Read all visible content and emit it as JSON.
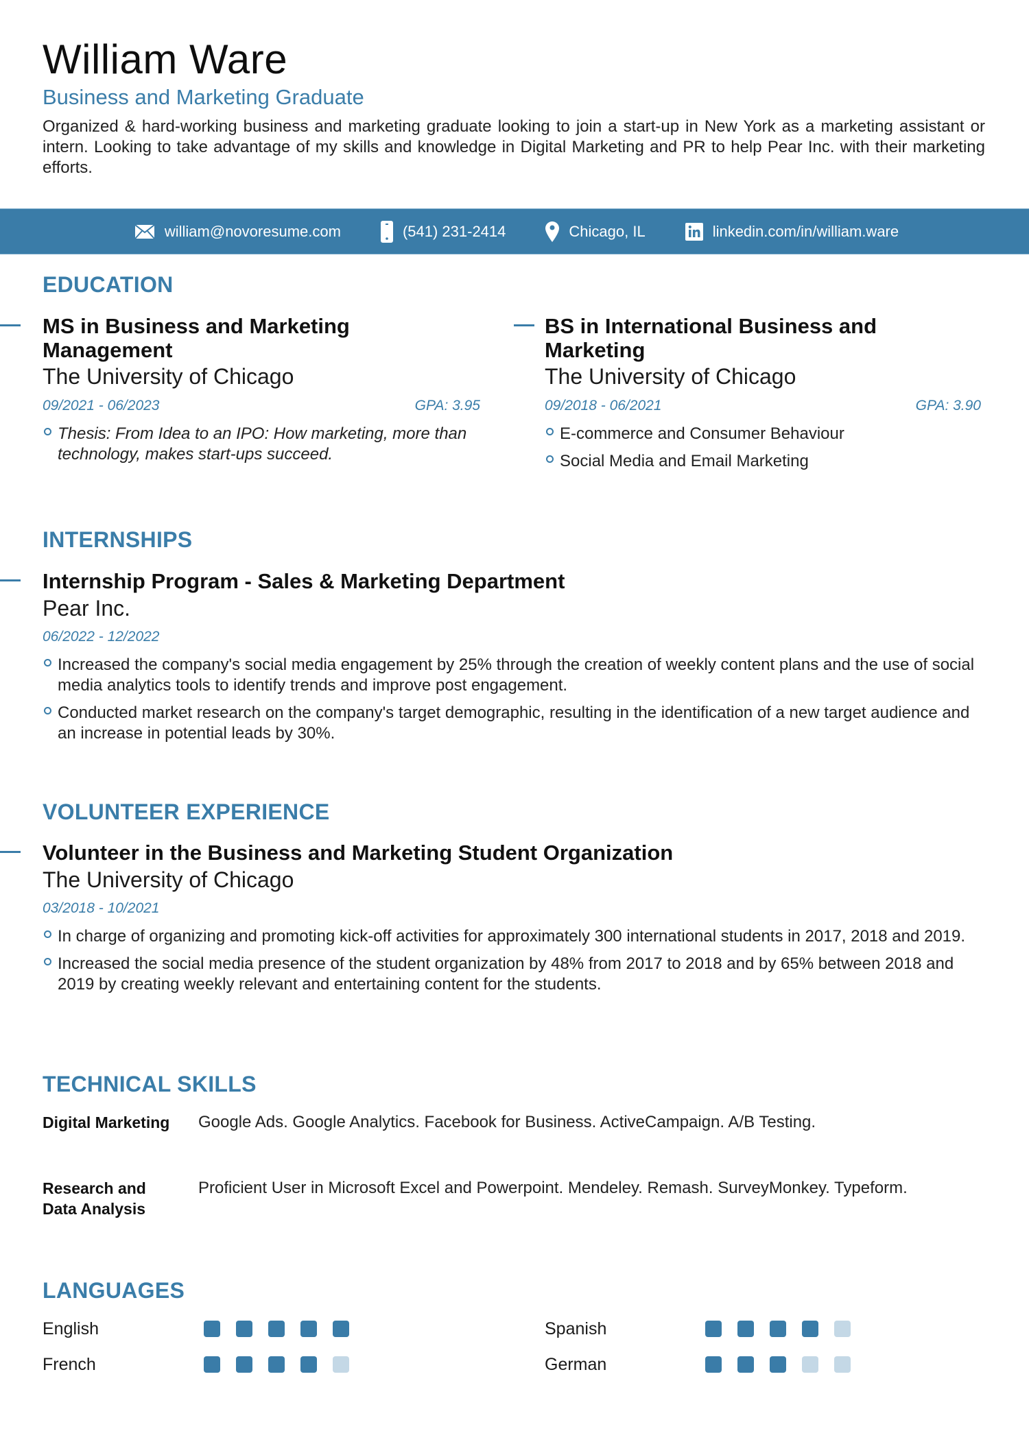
{
  "header": {
    "name": "William Ware",
    "headline": "Business and Marketing Graduate",
    "summary": "Organized & hard-working business and marketing graduate looking to join a start-up in New York as a marketing assistant or intern. Looking to take advantage of my skills and knowledge in Digital Marketing and PR to help Pear Inc. with their marketing efforts."
  },
  "contact": {
    "email": {
      "icon": "envelope-icon",
      "text": "william@novoresume.com"
    },
    "phone": {
      "icon": "phone-icon",
      "text": "(541) 231-2414"
    },
    "location": {
      "icon": "map-pin-icon",
      "text": "Chicago, IL"
    },
    "linkedin": {
      "icon": "linkedin-icon",
      "text": "linkedin.com/in/william.ware"
    }
  },
  "education": {
    "title": "EDUCATION",
    "items": [
      {
        "degree": "MS in Business and Marketing Management",
        "school": "The University of Chicago",
        "dates": "09/2021 - 06/2023",
        "gpa": "GPA: 3.95",
        "bullets": [
          "Thesis: From Idea to an IPO: How marketing, more than technology, makes start-ups succeed."
        ]
      },
      {
        "degree": "BS in International Business and Marketing",
        "school": "The University of Chicago",
        "dates": "09/2018 - 06/2021",
        "gpa": "GPA: 3.90",
        "bullets": [
          "E-commerce and Consumer Behaviour",
          "Social Media and Email Marketing"
        ]
      }
    ]
  },
  "internships": {
    "title": "INTERNSHIPS",
    "items": [
      {
        "role": "Internship Program - Sales & Marketing Department",
        "org": "Pear Inc.",
        "dates": "06/2022 - 12/2022",
        "bullets": [
          "Increased the company's social media engagement by 25% through the creation of weekly content plans and the use of social media analytics tools to identify trends and improve post engagement.",
          "Conducted market research on the company's target demographic, resulting in the identification of a new target audience and an increase in potential leads by 30%."
        ]
      }
    ]
  },
  "volunteer": {
    "title": "VOLUNTEER EXPERIENCE",
    "items": [
      {
        "role": "Volunteer in the Business and Marketing Student Organization",
        "org": "The University of Chicago",
        "dates": "03/2018 - 10/2021",
        "bullets": [
          "In charge of organizing and promoting kick-off activities for approximately 300 international students in 2017, 2018 and 2019.",
          "Increased the social media presence of the student organization by 48% from 2017 to 2018 and by 65% between 2018 and 2019 by creating weekly relevant and entertaining content for the students."
        ]
      }
    ]
  },
  "skills": {
    "title": "TECHNICAL SKILLS",
    "items": [
      {
        "label": "Digital Marketing",
        "value": "Google Ads. Google Analytics. Facebook for Business. ActiveCampaign. A/B Testing."
      },
      {
        "label": "Research and Data Analysis",
        "value": "Proficient User in Microsoft Excel and Powerpoint. Mendeley. Remash. SurveyMonkey. Typeform."
      }
    ]
  },
  "languages": {
    "title": "LANGUAGES",
    "max_level": 5,
    "items": [
      {
        "name": "English",
        "level": 5
      },
      {
        "name": "Spanish",
        "level": 4
      },
      {
        "name": "French",
        "level": 4
      },
      {
        "name": "German",
        "level": 3
      }
    ]
  },
  "colors": {
    "accent": "#3a7ca8",
    "accent_light": "#c4d8e6",
    "text": "#1a1a1a"
  }
}
